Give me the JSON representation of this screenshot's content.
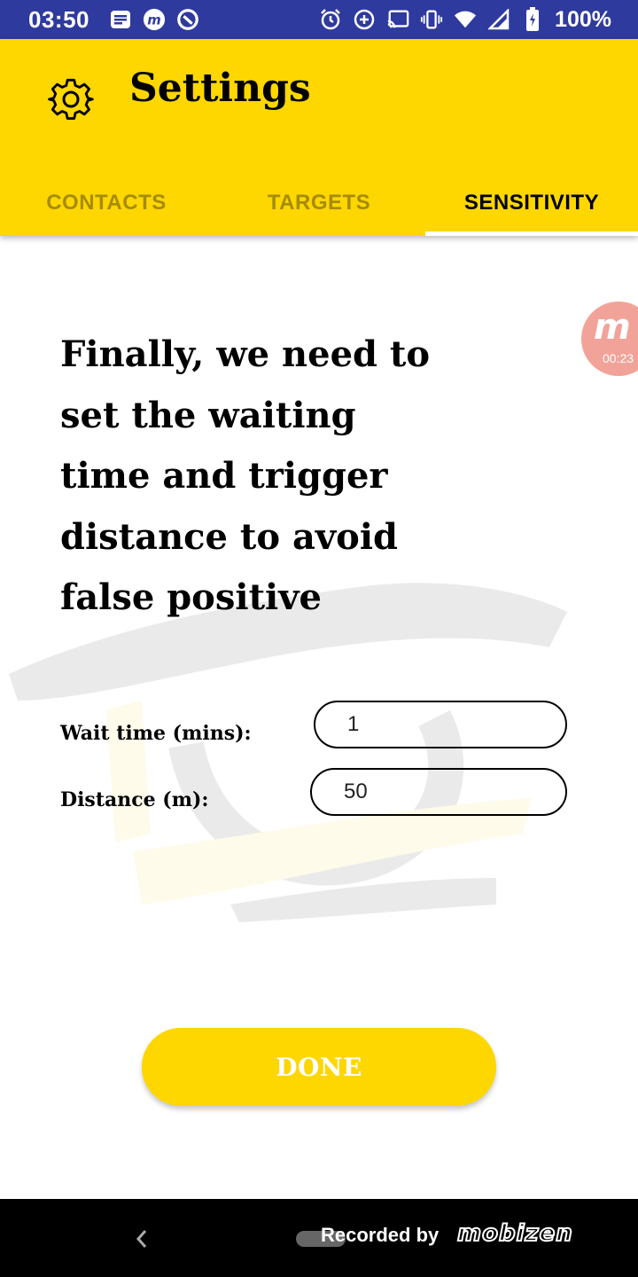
{
  "status_bar": {
    "time": "03:50",
    "battery": "100%",
    "left_icons": [
      "message-icon",
      "mobizen-icon",
      "sync-icon"
    ],
    "right_icons": [
      "alarm-icon",
      "data-saver-icon",
      "cast-icon",
      "vibrate-icon",
      "wifi-icon",
      "signal-icon",
      "battery-icon"
    ]
  },
  "app_bar": {
    "title": "Settings",
    "color": "#fed600",
    "tabs": [
      "CONTACTS",
      "TARGETS",
      "SENSITIVITY"
    ],
    "active_tab": "SENSITIVITY"
  },
  "content": {
    "heading_lines": [
      "Finally, we need to",
      "set the waiting",
      "time and trigger",
      "distance to avoid",
      "false positive"
    ],
    "wait_time": {
      "label": "Wait time (mins):",
      "value": "1"
    },
    "distance": {
      "label": "Distance (m):",
      "value": "50"
    },
    "done_label": "DONE"
  },
  "record_badge": {
    "letter": "m",
    "time": "00:23"
  },
  "nav_bar": {
    "recorded_by": "Recorded by",
    "brand": "mobizen"
  }
}
